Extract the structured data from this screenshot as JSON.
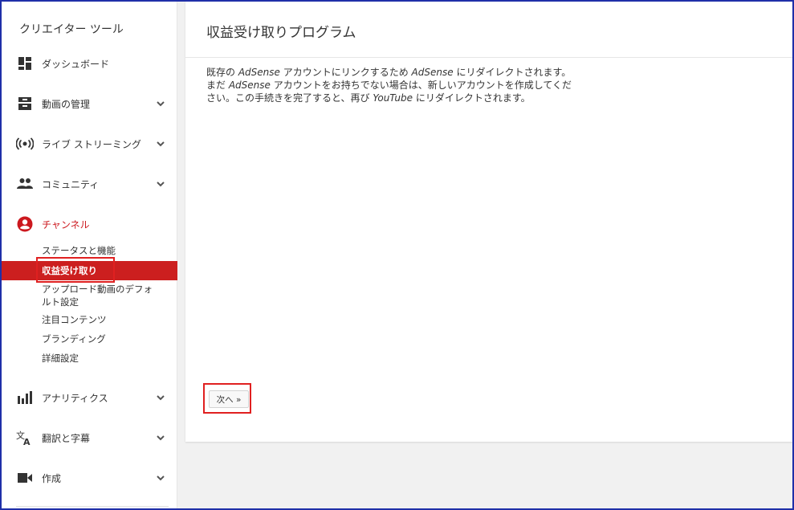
{
  "sidebar": {
    "title": "クリエイター ツール",
    "items": [
      {
        "label": "ダッシュボード",
        "icon": "dashboard-icon",
        "has_chevron": false
      },
      {
        "label": "動画の管理",
        "icon": "video-manager-icon",
        "has_chevron": true
      },
      {
        "label": "ライブ ストリーミング",
        "icon": "live-streaming-icon",
        "has_chevron": true
      },
      {
        "label": "コミュニティ",
        "icon": "community-icon",
        "has_chevron": true
      },
      {
        "label": "チャンネル",
        "icon": "channel-icon",
        "has_chevron": false,
        "active": true
      },
      {
        "label": "アナリティクス",
        "icon": "analytics-icon",
        "has_chevron": true
      },
      {
        "label": "翻訳と字幕",
        "icon": "translate-icon",
        "has_chevron": true
      },
      {
        "label": "作成",
        "icon": "create-icon",
        "has_chevron": true
      }
    ],
    "channel_subitems": [
      {
        "label": "ステータスと機能"
      },
      {
        "label": "収益受け取り",
        "selected": true
      },
      {
        "label": "アップロード動画のデフォ",
        "line2": "ルト設定"
      },
      {
        "label": "注目コンテンツ"
      },
      {
        "label": "ブランディング"
      },
      {
        "label": "詳細設定"
      }
    ]
  },
  "main": {
    "title": "収益受け取りプログラム",
    "text": {
      "p1": "既存の ",
      "p2": "AdSense",
      "p3": " アカウントにリンクするため ",
      "p4": "AdSense",
      "p5": " にリダイレクトされます。まだ ",
      "p6": "AdSense",
      "p7": " アカウントをお持ちでない場合は、新しいアカウントを作成してください。この手続きを完了すると、再び ",
      "p8": "YouTube",
      "p9": " にリダイレクトされます。"
    },
    "next_label": "次へ »"
  },
  "colors": {
    "accent_red": "#cc1f1f",
    "highlight_red": "#e02020",
    "frame_blue": "#1f2fa8"
  }
}
